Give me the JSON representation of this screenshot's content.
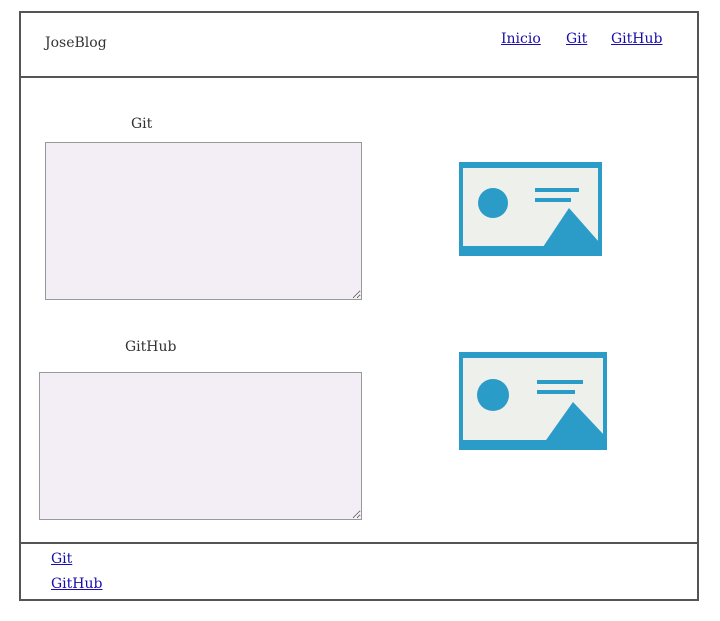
{
  "header": {
    "brand": "JoseBlog",
    "nav": [
      {
        "label": "Inicio"
      },
      {
        "label": "Git"
      },
      {
        "label": "GitHub"
      }
    ]
  },
  "main": {
    "sections": [
      {
        "title": "Git",
        "image_icon": "image-placeholder-icon",
        "text": ""
      },
      {
        "title": "GitHub",
        "image_icon": "image-placeholder-icon",
        "text": ""
      }
    ]
  },
  "footer": {
    "links": [
      {
        "label": "Git"
      },
      {
        "label": "GitHub"
      }
    ]
  },
  "colors": {
    "frame_border": "#555555",
    "link": "#1a0dab",
    "textarea_bg": "#f3eef5",
    "image_blue": "#2b9bc8",
    "image_bg": "#eef0ec"
  }
}
